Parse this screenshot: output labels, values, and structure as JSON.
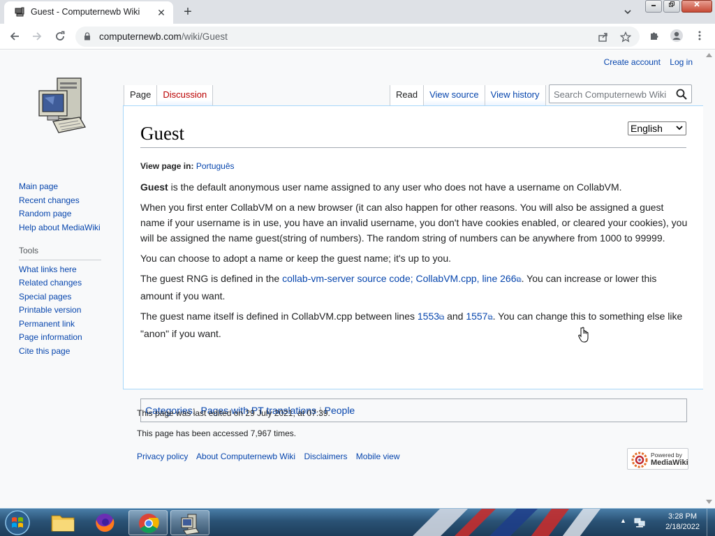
{
  "browser": {
    "tab_title": "Guest - Computernewb Wiki",
    "tab_close": "✕",
    "new_tab": "+",
    "tab_search": "⌄",
    "url_domain": "computernewb.com",
    "url_path": "/wiki/Guest"
  },
  "wiki": {
    "personal": {
      "create_account": "Create account",
      "log_in": "Log in"
    },
    "tabs_left": [
      "Page",
      "Discussion"
    ],
    "tabs_right": [
      "Read",
      "View source",
      "View history"
    ],
    "search_placeholder": "Search Computernewb Wiki",
    "sidebar": {
      "nav": [
        "Main page",
        "Recent changes",
        "Random page",
        "Help about MediaWiki"
      ],
      "tools_heading": "Tools",
      "tools": [
        "What links here",
        "Related changes",
        "Special pages",
        "Printable version",
        "Permanent link",
        "Page information",
        "Cite this page"
      ]
    },
    "language_select": "English",
    "title": "Guest",
    "view_in_label": "View page in:",
    "view_in_lang": "Português",
    "p1_bold": "Guest",
    "p1_rest": " is the default anonymous user name assigned to any user who does not have a username on CollabVM.",
    "p2": "When you first enter CollabVM on a new browser (it can also happen for other reasons. You will also be assigned a guest name if your username is in use, you have an invalid username, you don't have cookies enabled, or cleared your cookies), you will be assigned the name guest(string of numbers). The random string of numbers can be anywhere from 1000 to 99999.",
    "p3": "You can choose to adopt a name or keep the guest name; it's up to you.",
    "p4_pre": "The guest RNG is defined in the ",
    "p4_link": "collab-vm-server source code; CollabVM.cpp, line 266",
    "p4_post": ". You can increase or lower this amount if you want.",
    "p5_pre": "The guest name itself is defined in CollabVM.cpp between lines ",
    "p5_link1": "1553",
    "p5_mid": " and ",
    "p5_link2": "1557",
    "p5_post": ". You can change this to something else like \"anon\" if you want.",
    "categories_label": "Categories",
    "categories": [
      "Pages with PT translations",
      "People"
    ],
    "footer": {
      "last_edited": "This page was last edited on 29 July 2021, at 07:39.",
      "accessed": "This page has been accessed 7,967 times.",
      "links": [
        "Privacy policy",
        "About Computernewb Wiki",
        "Disclaimers",
        "Mobile view"
      ],
      "powered_line1": "Powered by",
      "powered_line2": "MediaWiki"
    }
  },
  "taskbar": {
    "time": "3:28 PM",
    "date": "2/18/2022"
  },
  "colors": {
    "link": "#0645ad",
    "redlink": "#ba0000",
    "content_border": "#a7d7f9"
  }
}
